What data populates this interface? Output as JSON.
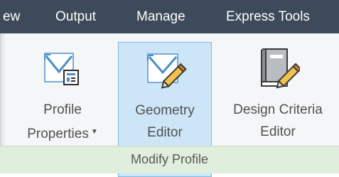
{
  "tabs": [
    {
      "label": "ew"
    },
    {
      "label": "Output"
    },
    {
      "label": "Manage"
    },
    {
      "label": "Express Tools"
    }
  ],
  "panel": {
    "group_label": "Modify Profile",
    "buttons": [
      {
        "line1": "Profile",
        "line2": "Properties",
        "icon": "profile-properties-icon",
        "has_dropdown": true
      },
      {
        "line1": "Geometry",
        "line2": "Editor",
        "icon": "geometry-editor-icon",
        "active": true
      },
      {
        "line1": "Design Criteria",
        "line2": "Editor",
        "icon": "design-criteria-editor-icon"
      }
    ]
  },
  "colors": {
    "tabbar": "#3c4a59",
    "ribbon": "#f5f6f7",
    "active_button": "#cde6f7",
    "group_bar": "#dfeedd",
    "icon_blue": "#4a8fc7"
  }
}
